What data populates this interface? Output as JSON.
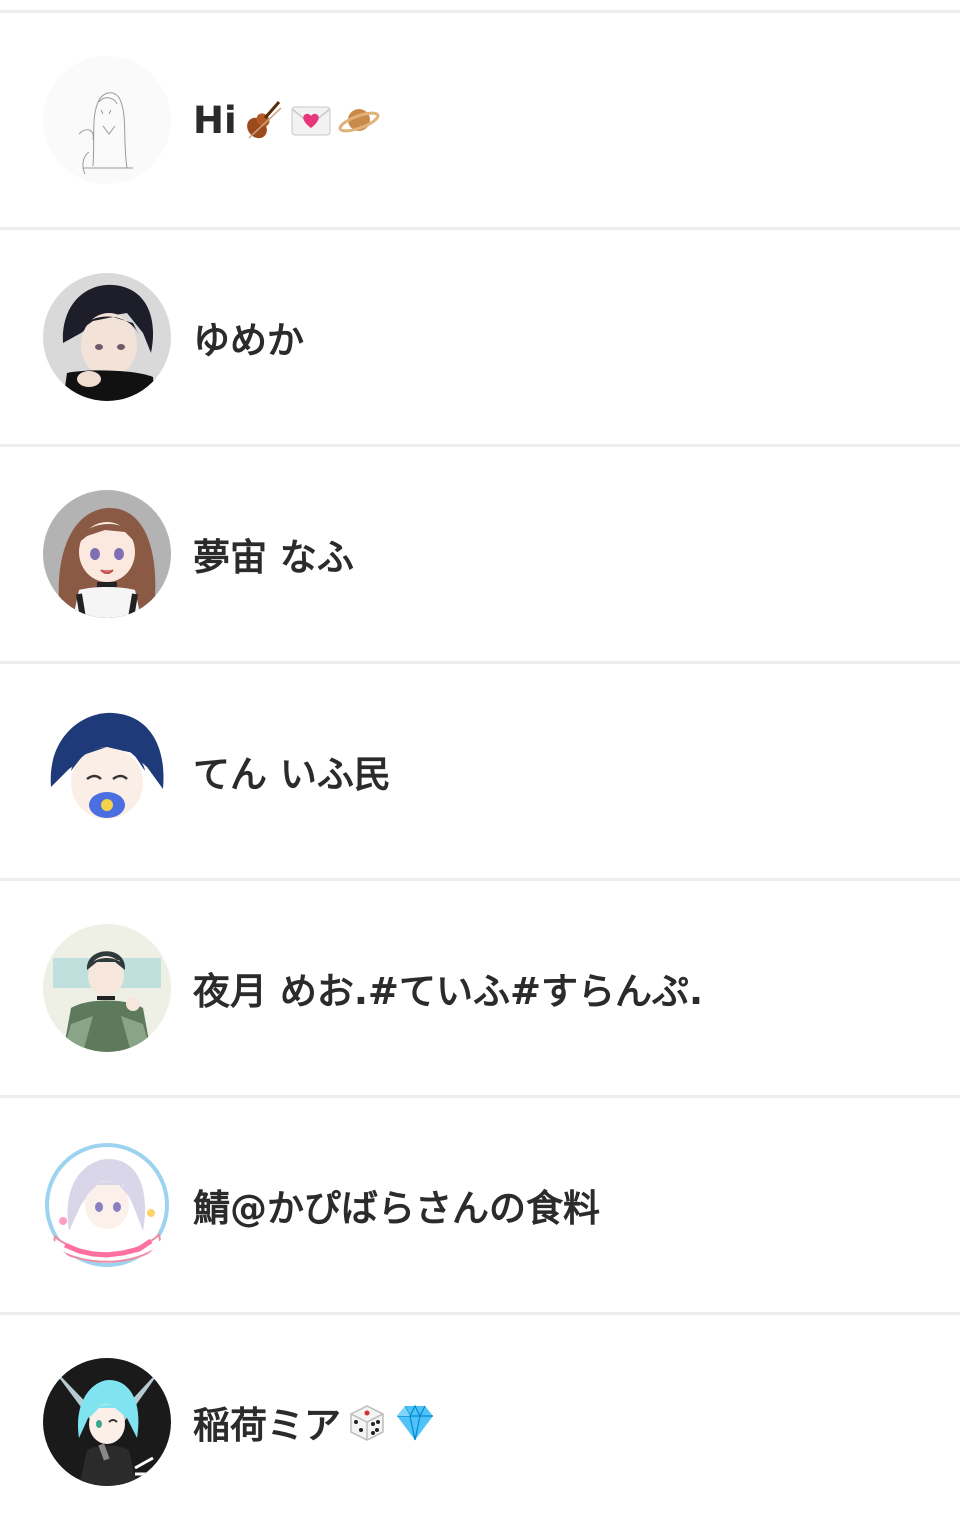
{
  "users": [
    {
      "name": "Hi",
      "emojis": [
        "violin-emoji",
        "love-letter-emoji",
        "ringed-planet-emoji"
      ],
      "avatar": "sketch-avatar"
    },
    {
      "name": "ゆめか",
      "emojis": [],
      "avatar": "dark-hair-boy-avatar"
    },
    {
      "name": "夢宙 なふ",
      "emojis": [],
      "avatar": "brown-hair-girl-avatar"
    },
    {
      "name": "てん いふ民",
      "emojis": [],
      "avatar": "blue-hair-pacifier-avatar"
    },
    {
      "name": "夜月 めお.#ていふ#すらんぷ.",
      "emojis": [],
      "avatar": "green-jacket-avatar"
    },
    {
      "name": "鯖@かぴばらさんの食料",
      "emojis": [],
      "avatar": "summer-tour-badge-avatar"
    },
    {
      "name": "稲荷ミア",
      "emojis": [
        "game-die-emoji",
        "gem-stone-emoji"
      ],
      "avatar": "cyan-hair-singer-avatar"
    }
  ],
  "colors": {
    "text": "#2b2b2b",
    "divider": "#ededed",
    "background": "#ffffff"
  }
}
